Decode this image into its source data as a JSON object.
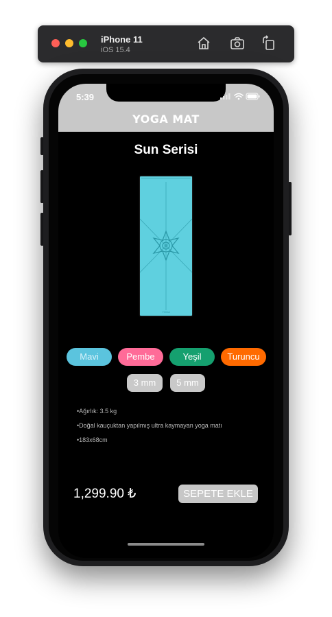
{
  "simulator": {
    "device_name": "iPhone 11",
    "os_version": "iOS 15.4",
    "icons": [
      "home-icon",
      "screenshot-icon",
      "rotate-icon"
    ]
  },
  "status_bar": {
    "time": "5:39",
    "icons": [
      "signal-icon",
      "wifi-icon",
      "battery-icon"
    ]
  },
  "nav": {
    "title": "YOGA MAT"
  },
  "product": {
    "title": "Sun Serisi",
    "mat_color": "#5fd0df"
  },
  "colors": [
    {
      "label": "Mavi",
      "color": "#5bc4de"
    },
    {
      "label": "Pembe",
      "color": "#ff6b98"
    },
    {
      "label": "Yeşil",
      "color": "#15a06f"
    },
    {
      "label": "Turuncu",
      "color": "#ff6a00"
    }
  ],
  "sizes": [
    "3 mm",
    "5 mm"
  ],
  "features": [
    "•Ağırlık: 3.5 kg",
    "•Doğal kauçuktan yapılmış ultra kaymayan yoga matı",
    "•183x68cm"
  ],
  "price": "1,299.90 ₺",
  "add_to_cart_label": "SEPETE EKLE"
}
